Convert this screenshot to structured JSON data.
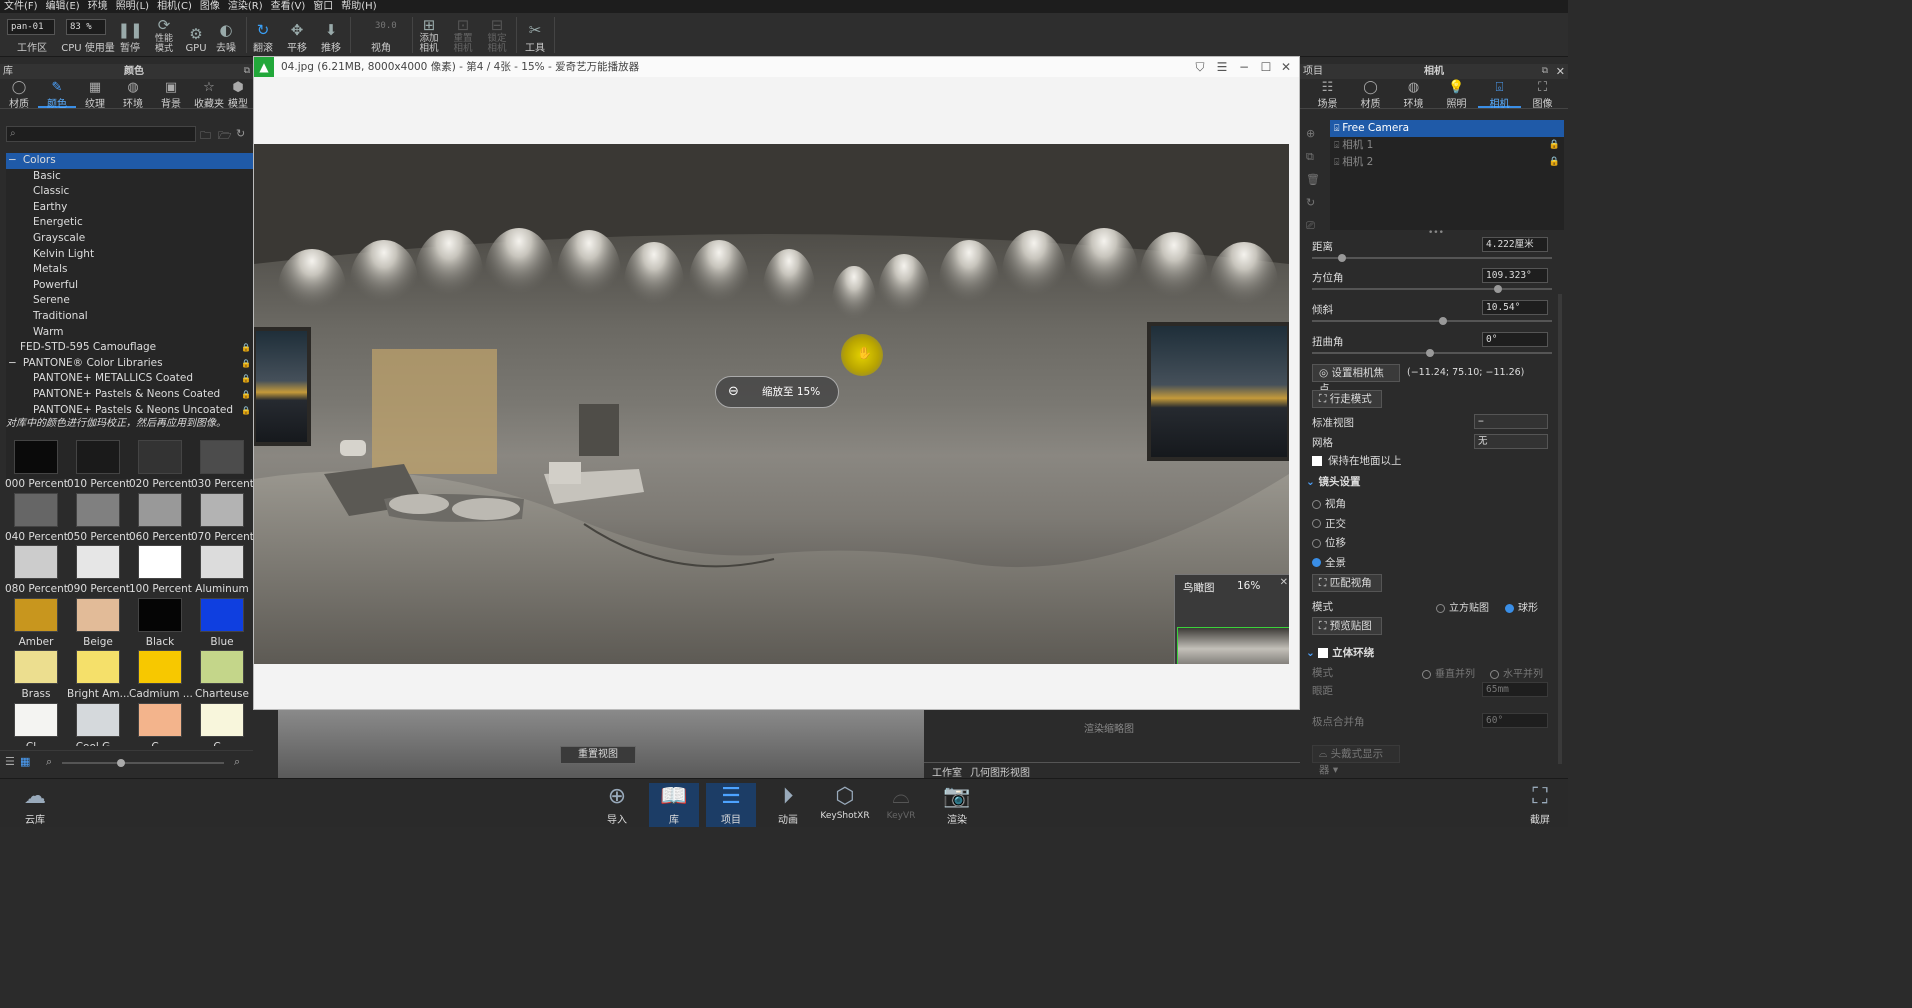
{
  "menu": [
    "文件(F)",
    "编辑(E)",
    "环境",
    "照明(L)",
    "相机(C)",
    "图像",
    "渲染(R)",
    "查看(V)",
    "窗口",
    "帮助(H)"
  ],
  "toolbar": {
    "workspace_value": "pan-01",
    "workspace_label": "工作区",
    "cpu_value": "83 %",
    "cpu_label": "CPU 使用量",
    "pause_label": "暂停",
    "perf_label": "性能模式",
    "gpu_label": "GPU",
    "denoise_label": "去噪",
    "tumble_label": "翻滚",
    "pan_label": "平移",
    "dolly_label": "推移",
    "fov_value": "30.0",
    "fov_label": "视角",
    "add_camera_label": "添加相机",
    "reset_camera_label": "重置相机",
    "lock_camera_label": "锁定相机",
    "tools_label": "工具"
  },
  "left": {
    "header_left": "库",
    "header_title": "颜色",
    "tabs": [
      "材质",
      "颜色",
      "纹理",
      "环境",
      "背景",
      "收藏夹",
      "模型"
    ],
    "tree": [
      {
        "label": "Colors",
        "indent": 0,
        "toggle": "−"
      },
      {
        "label": "Basic",
        "indent": 1
      },
      {
        "label": "Classic",
        "indent": 1
      },
      {
        "label": "Earthy",
        "indent": 1
      },
      {
        "label": "Energetic",
        "indent": 1
      },
      {
        "label": "Grayscale",
        "indent": 1
      },
      {
        "label": "Kelvin Light",
        "indent": 1
      },
      {
        "label": "Metals",
        "indent": 1
      },
      {
        "label": "Powerful",
        "indent": 1
      },
      {
        "label": "Serene",
        "indent": 1
      },
      {
        "label": "Traditional",
        "indent": 1
      },
      {
        "label": "Warm",
        "indent": 1
      },
      {
        "label": "FED-STD-595 Camouflage",
        "indent": 0,
        "lock": true
      },
      {
        "label": "PANTONE® Color Libraries",
        "indent": 0,
        "toggle": "−",
        "lock": true
      },
      {
        "label": "PANTONE+ METALLICS Coated",
        "indent": 1,
        "lock": true
      },
      {
        "label": "PANTONE+ Pastels & Neons Coated",
        "indent": 1,
        "lock": true
      },
      {
        "label": "PANTONE+ Pastels & Neons Uncoated",
        "indent": 1,
        "lock": true
      }
    ],
    "notice": "对库中的颜色进行伽玛校正，然后再应用到图像。",
    "swatches": [
      {
        "name": "000 Percent",
        "color": "#0a0a0a"
      },
      {
        "name": "010 Percent",
        "color": "#1a1a1a"
      },
      {
        "name": "020 Percent",
        "color": "#333333"
      },
      {
        "name": "030 Percent",
        "color": "#4c4c4c"
      },
      {
        "name": "040 Percent",
        "color": "#666666"
      },
      {
        "name": "050 Percent",
        "color": "#808080"
      },
      {
        "name": "060 Percent",
        "color": "#999999"
      },
      {
        "name": "070 Percent",
        "color": "#b3b3b3"
      },
      {
        "name": "080 Percent",
        "color": "#cccccc"
      },
      {
        "name": "090 Percent",
        "color": "#e6e6e6"
      },
      {
        "name": "100 Percent",
        "color": "#ffffff"
      },
      {
        "name": "Aluminum",
        "color": "#dcdcdc"
      },
      {
        "name": "Amber",
        "color": "#c8961e"
      },
      {
        "name": "Beige",
        "color": "#e2bb98"
      },
      {
        "name": "Black",
        "color": "#050505"
      },
      {
        "name": "Blue",
        "color": "#0f3fe0"
      },
      {
        "name": "Brass",
        "color": "#ecde8f"
      },
      {
        "name": "Bright Am...",
        "color": "#f5e06a"
      },
      {
        "name": "Cadmium ...",
        "color": "#f7c800"
      },
      {
        "name": "Charteuse",
        "color": "#c4d68a"
      },
      {
        "name": "Cl...",
        "color": "#f4f4f2"
      },
      {
        "name": "Cool G...",
        "color": "#d5d9dc"
      },
      {
        "name": "C...",
        "color": "#f3b48c"
      },
      {
        "name": "C...",
        "color": "#f8f6dc"
      }
    ]
  },
  "viewer": {
    "title": "04.jpg (6.21MB, 8000x4000 像素) - 第4 / 4张 - 15% - 爱奇艺万能播放器",
    "zoom_text": "缩放至 15%",
    "birdseye_label": "鸟瞰图",
    "birdseye_pct": "16%"
  },
  "bottom_area": {
    "reset_view": "重置视图",
    "render_thumb": "渲染缩略图",
    "tab_workspace": "工作室",
    "tab_geometry": "几何图形视图"
  },
  "right": {
    "header_left": "项目",
    "header_title": "相机",
    "tabs": [
      "场景",
      "材质",
      "环境",
      "照明",
      "相机",
      "图像"
    ],
    "cameras": [
      "Free Camera",
      "相机 1",
      "相机 2"
    ],
    "distance_label": "距离",
    "distance_value": "4.222厘米",
    "azimuth_label": "方位角",
    "azimuth_value": "109.323°",
    "incline_label": "倾斜",
    "incline_value": "10.54°",
    "twist_label": "扭曲角",
    "twist_value": "0°",
    "focus_btn": "设置相机焦点",
    "focus_coords": "(−11.24; 75.10; −11.26)",
    "walk_btn": "行走模式",
    "standard_view_label": "标准视图",
    "standard_view_value": "−",
    "grid_label": "网格",
    "grid_value": "无",
    "keep_above_ground": "保持在地面以上",
    "lens_section": "镜头设置",
    "lens_options": [
      "视角",
      "正交",
      "位移",
      "全景"
    ],
    "lens_selected": "全景",
    "match_fov_btn": "匹配视角",
    "mode_label": "模式",
    "mode_cube": "立方贴图",
    "mode_sphere": "球形",
    "preview_btn": "预览贴图",
    "stereo_section": "立体环绕",
    "stereo_mode_label": "模式",
    "stereo_vertical": "垂直并列",
    "stereo_horizontal": "水平并列",
    "ipd_label": "眼距",
    "ipd_value": "65mm",
    "pole_label": "极点合并角",
    "pole_value": "60°",
    "hmd_btn": "头戴式显示器"
  },
  "bottombar": {
    "cloud": "云库",
    "items": [
      "导入",
      "库",
      "项目",
      "动画",
      "KeyShotXR",
      "KeyVR",
      "渲染"
    ],
    "screenshot": "截屏"
  }
}
